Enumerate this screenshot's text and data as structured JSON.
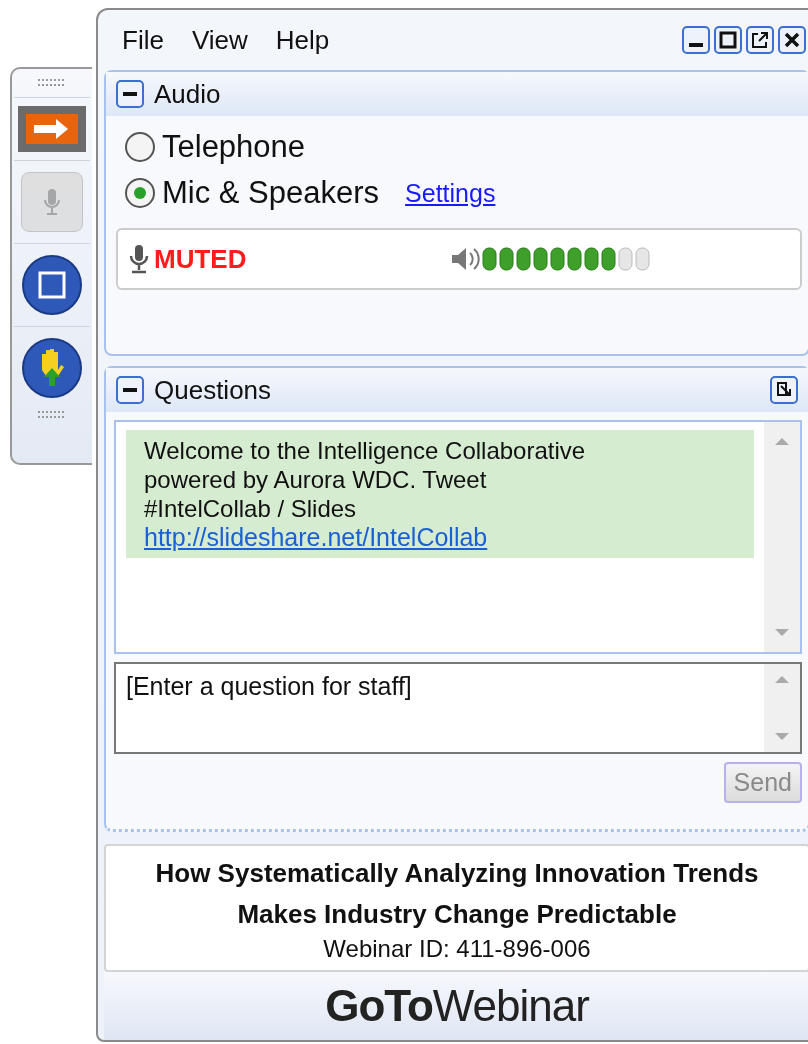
{
  "toolbar": {
    "buttons": [
      {
        "kind": "arrow",
        "selected": true,
        "disabled": false
      },
      {
        "kind": "mic",
        "selected": false,
        "disabled": true
      },
      {
        "kind": "screen",
        "selected": false,
        "disabled": false
      },
      {
        "kind": "hand",
        "selected": false,
        "disabled": false
      }
    ]
  },
  "menu": [
    "File",
    "View",
    "Help"
  ],
  "audio": {
    "title": "Audio",
    "expanded": true,
    "options": [
      {
        "label": "Telephone",
        "selected": false
      },
      {
        "label": "Mic & Speakers",
        "selected": true
      }
    ],
    "settings_link": "Settings",
    "mic_status": "MUTED",
    "speaker": {
      "level": 0.8
    }
  },
  "questions": {
    "title": "Questions",
    "expanded": true,
    "message": {
      "text": "Welcome to the Intelligence Collaborative powered by Aurora WDC. Tweet #IntelCollab / Slides",
      "link": "http://slideshare.net/IntelCollab"
    },
    "input": {
      "placeholder": "[Enter a question for staff]"
    },
    "send": {
      "label": "Send",
      "disabled": true
    }
  },
  "webinar": {
    "title": "How Systematically Analyzing Innovation Trends Makes Industry Change Predictable",
    "id": "Webinar ID: 411-896-006"
  },
  "logo": "**GoTo**Webinar"
}
